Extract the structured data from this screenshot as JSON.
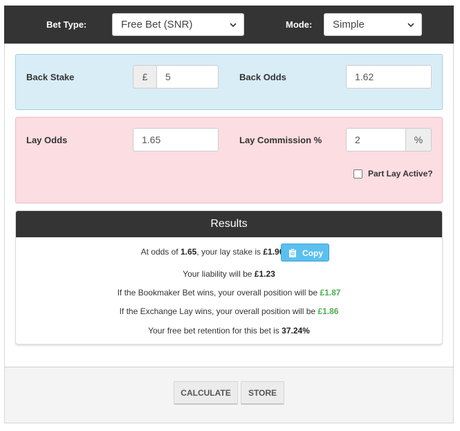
{
  "header": {
    "bet_type_label": "Bet Type:",
    "bet_type_value": "Free Bet (SNR)",
    "mode_label": "Mode:",
    "mode_value": "Simple"
  },
  "back": {
    "stake_label": "Back Stake",
    "currency_symbol": "£",
    "stake_value": "5",
    "odds_label": "Back Odds",
    "odds_value": "1.62"
  },
  "lay": {
    "odds_label": "Lay Odds",
    "odds_value": "1.65",
    "commission_label": "Lay Commission %",
    "commission_value": "2",
    "commission_unit": "%",
    "part_lay_label": "Part Lay Active?",
    "part_lay_checked": false
  },
  "results": {
    "title": "Results",
    "line1_pre": "At odds of ",
    "line1_odds": "1.65",
    "line1_mid": ", your lay stake is ",
    "line1_stake": "£1.90",
    "copy_label": "Copy",
    "line2_pre": "Your liability will be ",
    "line2_value": "£1.23",
    "line3_pre": "If the Bookmaker Bet wins, your overall position will be ",
    "line3_value": "£1.87",
    "line4_pre": "If the Exchange Lay wins, your overall position will be ",
    "line4_value": "£1.86",
    "line5_pre": "Your free bet retention for this bet is ",
    "line5_value": "37.24%"
  },
  "footer": {
    "calculate_label": "CALCULATE",
    "store_label": "STORE"
  },
  "colors": {
    "header_bg": "#343434",
    "back_panel": "#d9edf7",
    "lay_panel": "#fbdde2",
    "profit_green": "#4caf50",
    "copy_button": "#5bc0f0"
  }
}
